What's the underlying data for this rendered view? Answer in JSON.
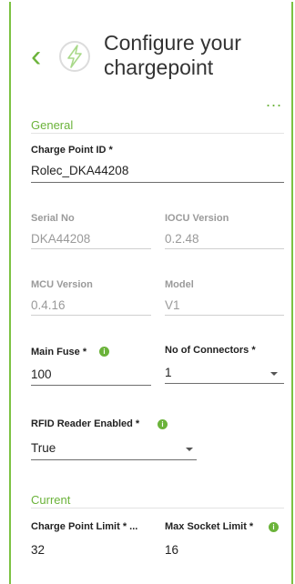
{
  "header": {
    "title_line1": "Configure your",
    "title_line2": "chargepoint",
    "menu": "..."
  },
  "general": {
    "section_title": "General",
    "charge_point_id": {
      "label": "Charge Point ID *",
      "value": "Rolec_DKA44208"
    },
    "serial_no": {
      "label": "Serial No",
      "value": "DKA44208"
    },
    "iocu_version": {
      "label": "IOCU Version",
      "value": "0.2.48"
    },
    "mcu_version": {
      "label": "MCU Version",
      "value": "0.4.16"
    },
    "model": {
      "label": "Model",
      "value": "V1"
    },
    "main_fuse": {
      "label": "Main Fuse *",
      "value": "100"
    },
    "no_of_connectors": {
      "label": "No of Connectors *",
      "value": "1"
    },
    "rfid_reader_enabled": {
      "label": "RFID Reader Enabled *",
      "value": "True"
    }
  },
  "current": {
    "section_title": "Current",
    "charge_point_limit": {
      "label": "Charge Point Limit * ...",
      "value": "32"
    },
    "max_socket_limit": {
      "label": "Max Socket Limit *",
      "value": "16"
    }
  },
  "colors": {
    "accent": "#6bb33a",
    "frame": "#7cc242"
  }
}
